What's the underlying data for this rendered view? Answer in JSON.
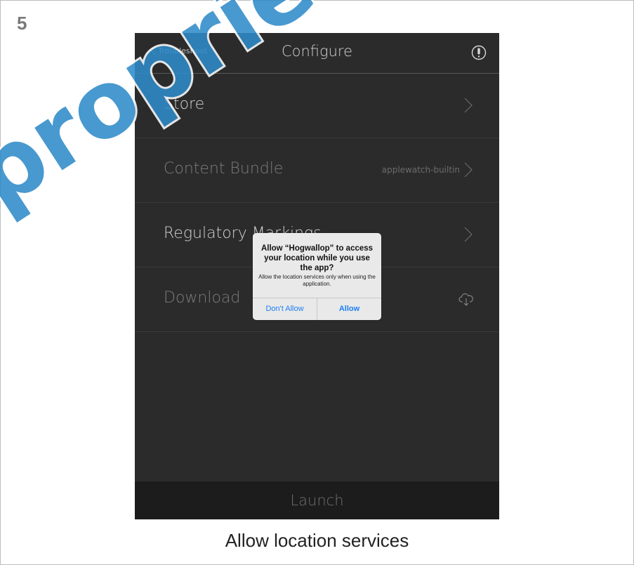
{
  "step": {
    "number": "5"
  },
  "watermark": {
    "text": "proprietary",
    "color": "#2e8bc9"
  },
  "navbar": {
    "back_label": "Troubleshoot",
    "back_icon": "chevron-left-icon",
    "title": "Configure",
    "info_icon": "info-icon"
  },
  "rows": [
    {
      "label": "Store",
      "detail": "",
      "accessory": "chevron-right-icon"
    },
    {
      "label": "Content Bundle",
      "detail": "applewatch-builtin",
      "accessory": "chevron-right-icon"
    },
    {
      "label": "Regulatory Markings",
      "detail": "",
      "accessory": "chevron-right-icon"
    },
    {
      "label": "Download",
      "detail": "",
      "accessory": "cloud-download-icon"
    }
  ],
  "launch": {
    "label": "Launch"
  },
  "alert": {
    "title": "Allow “Hogwallop” to access your location while you use the app?",
    "message": "Allow the location services only when using the application.",
    "deny_label": "Don't Allow",
    "allow_label": "Allow",
    "button_color": "#1a7ef5"
  },
  "caption": {
    "text": "Allow location services"
  }
}
